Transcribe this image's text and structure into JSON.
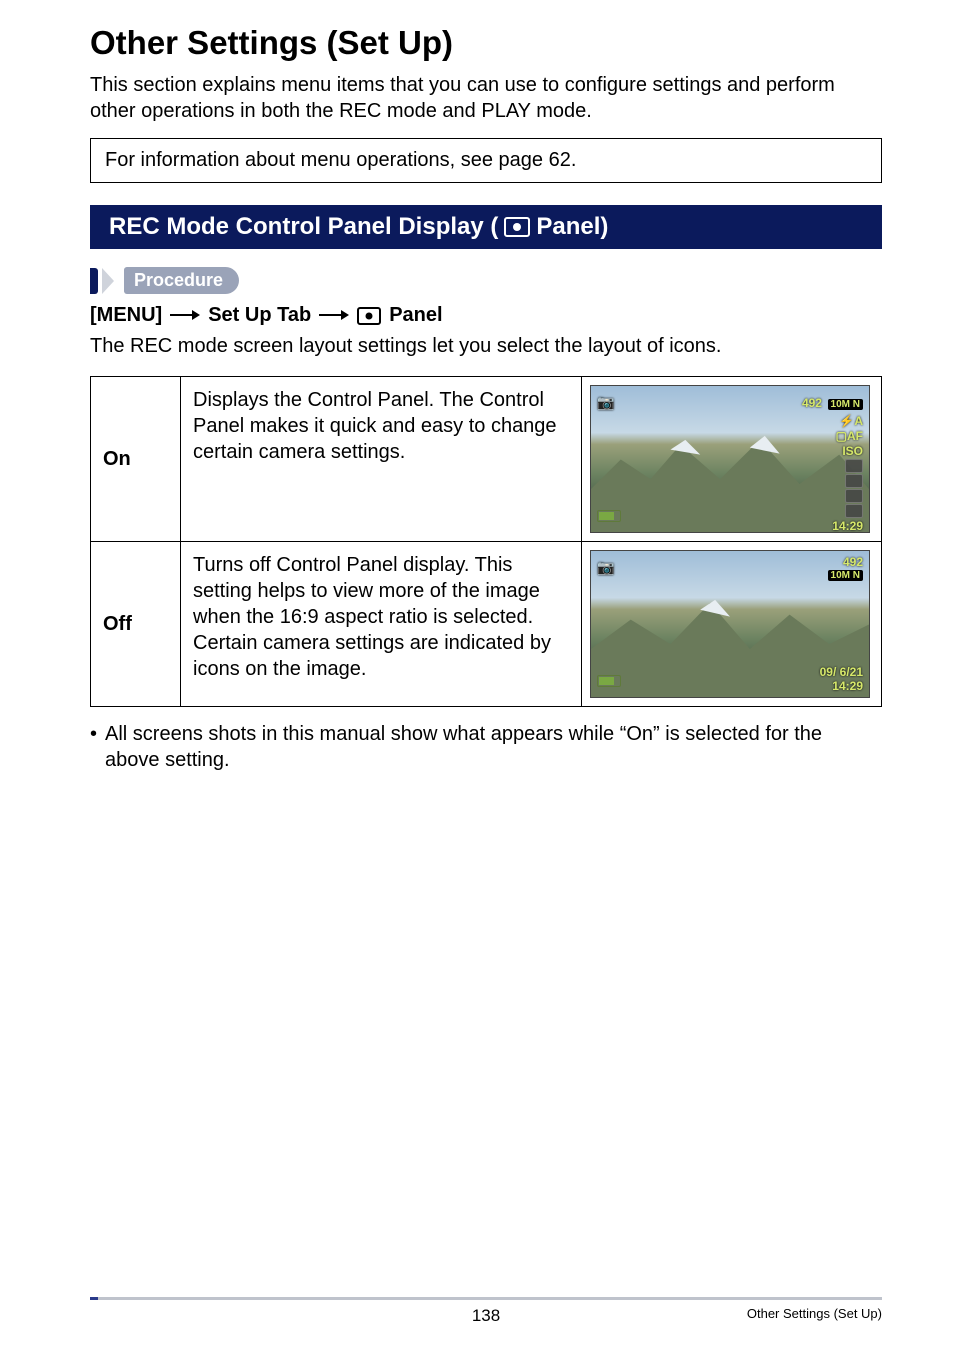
{
  "title": "Other Settings (Set Up)",
  "intro": "This section explains menu items that you can use to configure settings and perform other operations in both the REC mode and PLAY mode.",
  "info_box": "For information about menu operations, see page 62.",
  "section_bar": {
    "prefix": "REC Mode Control Panel Display (",
    "suffix": " Panel)"
  },
  "procedure_label": "Procedure",
  "breadcrumb": {
    "menu": "[MENU]",
    "tab": "Set Up Tab",
    "panel": "Panel"
  },
  "sub_intro": "The REC mode screen layout settings let you select the layout of icons.",
  "table": {
    "rows": [
      {
        "label": "On",
        "desc": "Displays the Control Panel. The Control Panel makes it quick and easy to change certain camera settings.",
        "overlay": {
          "counter": "492",
          "size_badge": "10M N",
          "flash": "⚡A",
          "af": "▢AF",
          "iso": "ISO",
          "time": "14:29",
          "show_side_icons": true
        }
      },
      {
        "label": "Off",
        "desc": "Turns off Control Panel display. This setting helps to view more of the image when the 16:9 aspect ratio is selected. Certain camera settings are indicated by icons on the image.",
        "overlay": {
          "counter": "492",
          "size_badge": "10M N",
          "date": "09/ 6/21",
          "time": "14:29",
          "show_side_icons": false
        }
      }
    ]
  },
  "bullet_note": "All screens shots in this manual show what appears while “On” is selected for the above setting.",
  "footer": {
    "page": "138",
    "section": "Other Settings (Set Up)"
  }
}
